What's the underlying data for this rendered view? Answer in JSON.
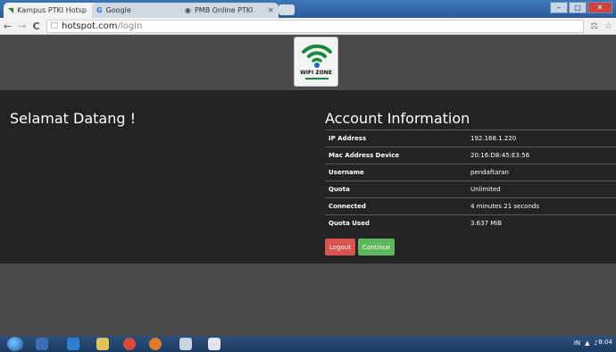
{
  "browser": {
    "tabs": [
      {
        "label": "Kampus PTKI Hotspot",
        "active": true
      },
      {
        "label": "Google",
        "active": false
      },
      {
        "label": "PMB Online PTKI",
        "active": false
      }
    ],
    "address": {
      "host": "hotspot.com",
      "path": "/login"
    }
  },
  "header": {
    "logo_text": "WIFI ZONE"
  },
  "main": {
    "welcome": "Selamat Datang !",
    "account_title": "Account Information",
    "rows": [
      {
        "key": "IP Address",
        "value": "192.168.1.220"
      },
      {
        "key": "Mac Address Device",
        "value": "20:16:D8:45:E3:56"
      },
      {
        "key": "Username",
        "value": "pendaftaran"
      },
      {
        "key": "Quota",
        "value": "Unlimited"
      },
      {
        "key": "Connected",
        "value": "4 minutes 21 seconds"
      },
      {
        "key": "Quota Used",
        "value": "3.637 MiB"
      }
    ],
    "logout_label": "Logout",
    "continue_label": "Continue"
  },
  "taskbar": {
    "lang": "IN",
    "time": "8:04"
  }
}
